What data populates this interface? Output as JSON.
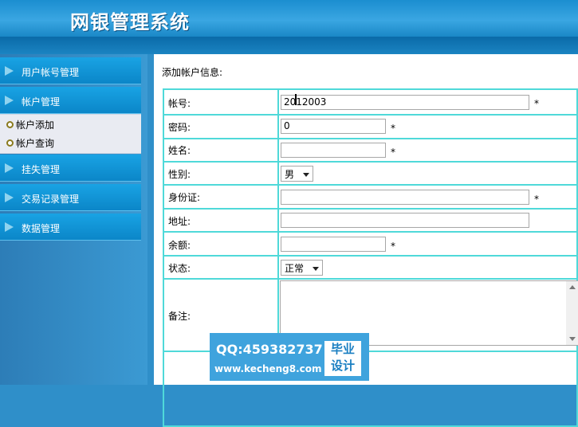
{
  "app": {
    "title": "网银管理系统"
  },
  "sidebar": {
    "menus": [
      {
        "label": "用户帐号管理"
      },
      {
        "label": "帐户管理"
      },
      {
        "label": "挂失管理"
      },
      {
        "label": "交易记录管理"
      },
      {
        "label": "数据管理"
      }
    ],
    "submenu": [
      {
        "label": "帐户添加"
      },
      {
        "label": "帐户查询"
      }
    ]
  },
  "main": {
    "section_title": "添加帐户信息:",
    "required_mark": "*",
    "fields": {
      "account": {
        "label": "帐号:",
        "value": "2012003"
      },
      "password": {
        "label": "密码:",
        "value": "0"
      },
      "name": {
        "label": "姓名:",
        "value": ""
      },
      "gender": {
        "label": "性别:",
        "value": "男"
      },
      "id_card": {
        "label": "身份证:",
        "value": ""
      },
      "address": {
        "label": "地址:",
        "value": ""
      },
      "balance": {
        "label": "余额:",
        "value": ""
      },
      "status": {
        "label": "状态:",
        "value": "正常"
      },
      "remark": {
        "label": "备注:",
        "value": ""
      }
    }
  },
  "watermark": {
    "qq": "QQ:459382737",
    "url": "www.kecheng8.com",
    "badge_line1": "毕业",
    "badge_line2": "设计"
  },
  "colors": {
    "header": "#1b8ed0",
    "table_border": "#4fd9d9",
    "sidebar_item": "#0b86c8"
  }
}
